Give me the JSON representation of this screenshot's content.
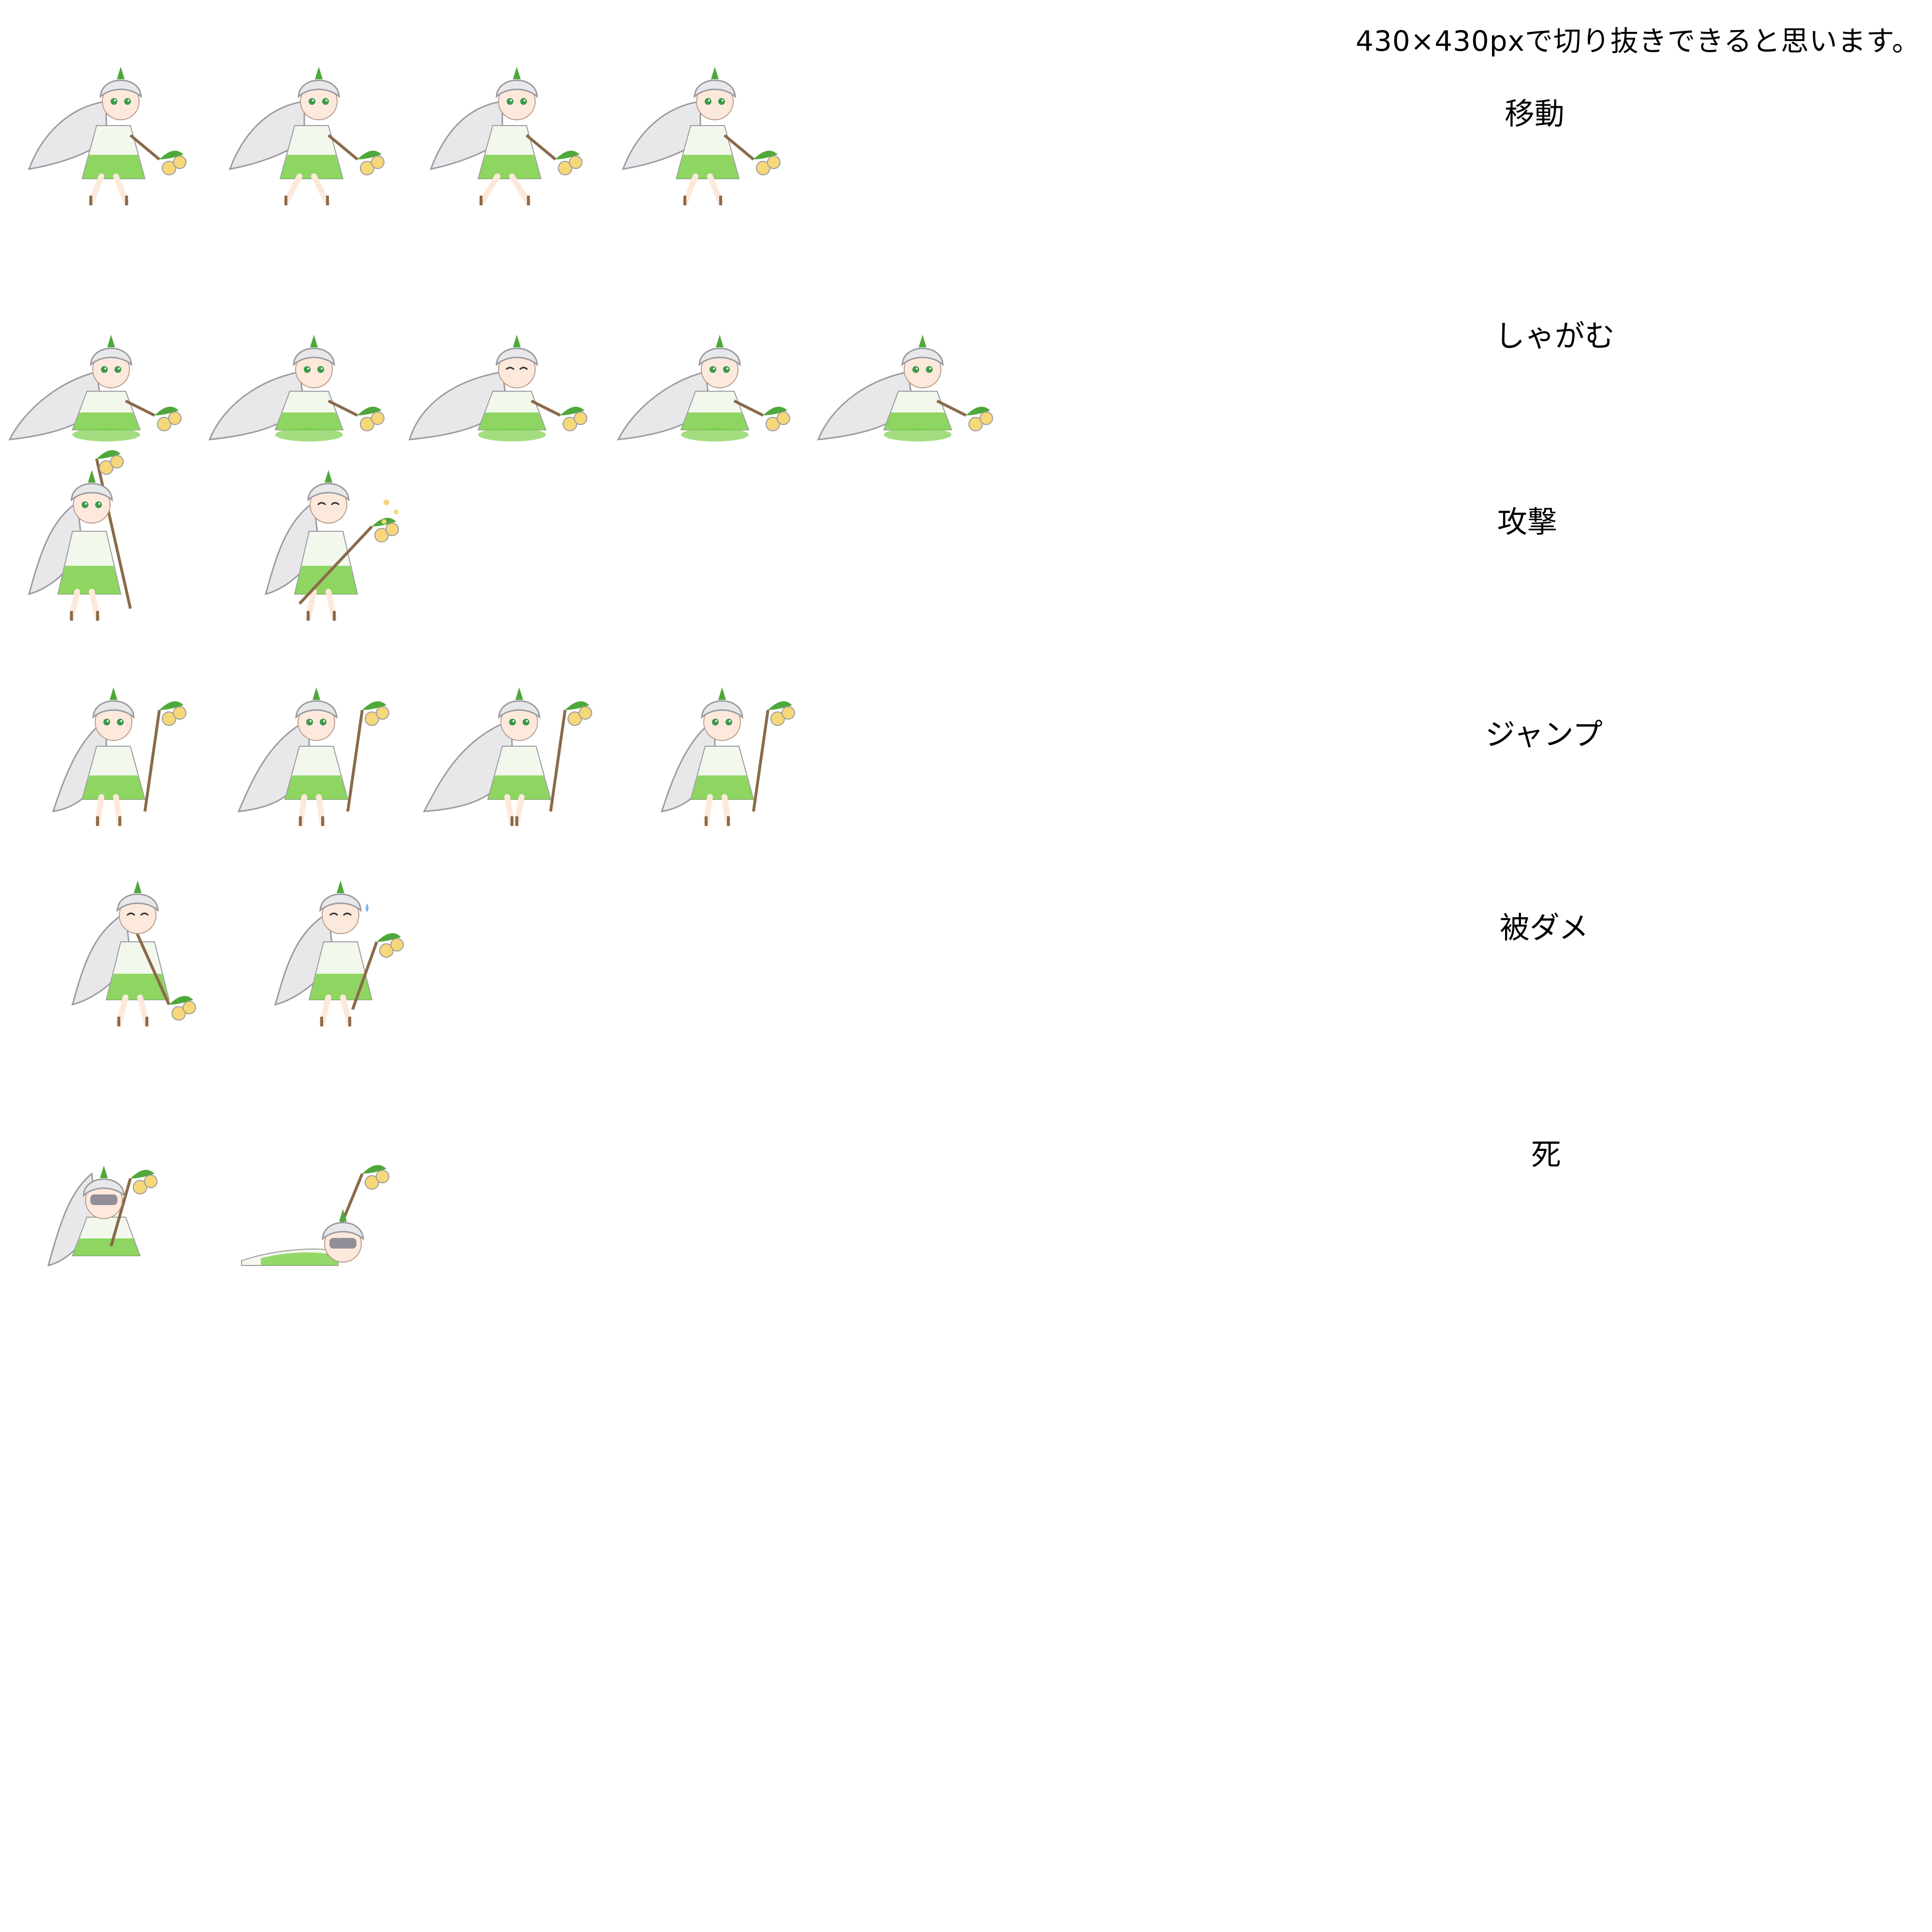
{
  "sheet": {
    "note": "430×430pxで切り抜きできると思います。",
    "palette": {
      "hair": "#e8e8ea",
      "hair_outline": "#9a9aa0",
      "dress_light": "#f2f8ec",
      "dress_green": "#7ccf4a",
      "leaf_green": "#4fa83a",
      "skin": "#fde9dc",
      "eye_green": "#3a9a4a",
      "flower_yellow": "#f6d77a",
      "staff_brown": "#8a6a4a",
      "dead_face": "#777788"
    },
    "rows": [
      {
        "label": "移動",
        "pose": "run",
        "frames": [
          {
            "name": "move-frame-1",
            "icon": "run-sprite"
          },
          {
            "name": "move-frame-2",
            "icon": "run-sprite"
          },
          {
            "name": "move-frame-3",
            "icon": "run-sprite"
          },
          {
            "name": "move-frame-4",
            "icon": "run-sprite"
          }
        ]
      },
      {
        "label": "しゃがむ",
        "pose": "crouch",
        "frames": [
          {
            "name": "crouch-frame-1",
            "icon": "crouch-sprite"
          },
          {
            "name": "crouch-frame-2",
            "icon": "crouch-sprite"
          },
          {
            "name": "crouch-frame-3",
            "icon": "crouch-sprite"
          },
          {
            "name": "crouch-frame-4",
            "icon": "crouch-sprite"
          },
          {
            "name": "crouch-frame-5",
            "icon": "crouch-sprite"
          }
        ]
      },
      {
        "label": "攻撃",
        "pose": "attack",
        "frames": [
          {
            "name": "attack-frame-1",
            "icon": "attack-sprite"
          },
          {
            "name": "attack-frame-2",
            "icon": "attack-sprite"
          }
        ]
      },
      {
        "label": "ジャンプ",
        "pose": "jump",
        "frames": [
          {
            "name": "jump-frame-1",
            "icon": "jump-sprite"
          },
          {
            "name": "jump-frame-2",
            "icon": "jump-sprite"
          },
          {
            "name": "jump-frame-3",
            "icon": "jump-sprite"
          },
          {
            "name": "jump-frame-4",
            "icon": "jump-sprite"
          }
        ]
      },
      {
        "label": "被ダメ",
        "pose": "hurt",
        "frames": [
          {
            "name": "hurt-frame-1",
            "icon": "hurt-sprite"
          },
          {
            "name": "hurt-frame-2",
            "icon": "hurt-sprite"
          }
        ]
      },
      {
        "label": "死",
        "pose": "death",
        "frames": [
          {
            "name": "death-frame-1",
            "icon": "death-sprite"
          },
          {
            "name": "death-frame-2",
            "icon": "death-sprite"
          }
        ]
      }
    ]
  }
}
